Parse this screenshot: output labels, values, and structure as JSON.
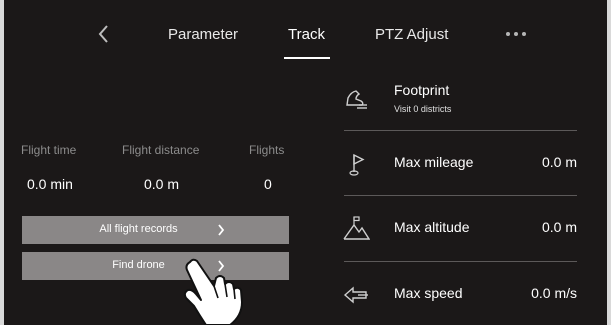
{
  "tabs": {
    "back_icon": "chevron-left-icon",
    "items": [
      "Parameter",
      "Track",
      "PTZ Adjust"
    ],
    "active": "Track",
    "more_icon": "more-icon"
  },
  "stats": [
    {
      "label": "Flight time",
      "value": "0.0 min"
    },
    {
      "label": "Flight distance",
      "value": "0.0 m"
    },
    {
      "label": "Flights",
      "value": "0"
    }
  ],
  "buttons": {
    "all_records": "All flight records",
    "find_drone": "Find drone"
  },
  "panel": {
    "footprint": {
      "title": "Footprint",
      "subtitle": "Visit 0 districts",
      "icon": "footprint-icon"
    },
    "rows": [
      {
        "title": "Max mileage",
        "value": "0.0 m",
        "icon": "mileage-flag-icon"
      },
      {
        "title": "Max altitude",
        "value": "0.0 m",
        "icon": "altitude-mountain-icon"
      },
      {
        "title": "Max speed",
        "value": "0.0 m/s",
        "icon": "speed-arrow-icon"
      }
    ]
  },
  "colors": {
    "background": "#1b1818",
    "button": "#8a8787",
    "divider": "#5c5959",
    "label": "#8c8c8c"
  }
}
